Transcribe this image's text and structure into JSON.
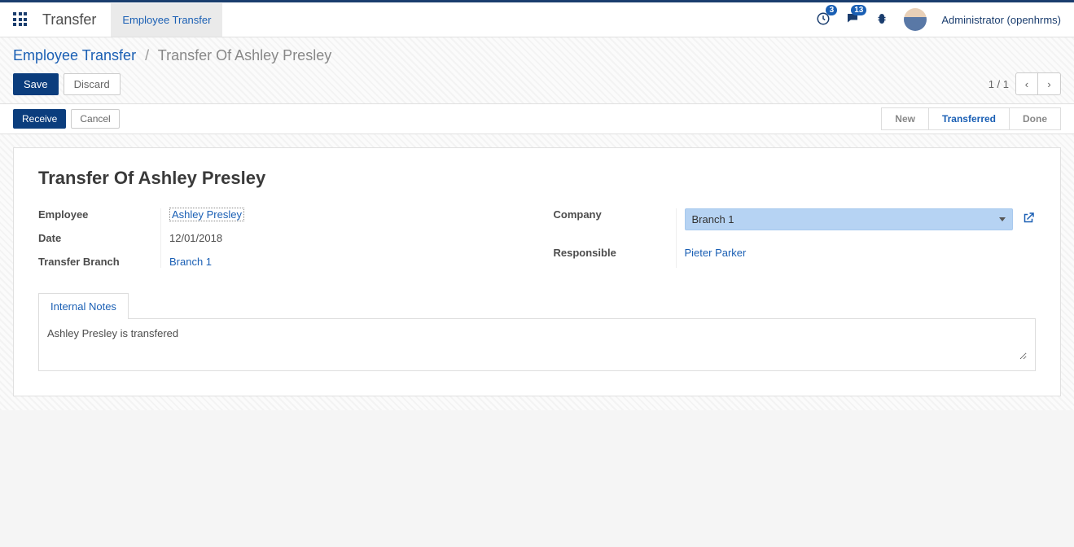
{
  "topbar": {
    "module": "Transfer",
    "active_tab": "Employee Transfer",
    "clock_badge": "3",
    "chat_badge": "13",
    "user": "Administrator (openhrms)"
  },
  "breadcrumb": {
    "root": "Employee Transfer",
    "current": "Transfer Of Ashley Presley"
  },
  "buttons": {
    "save": "Save",
    "discard": "Discard",
    "receive": "Receive",
    "cancel": "Cancel"
  },
  "pager": {
    "text": "1 / 1"
  },
  "status": {
    "new": "New",
    "transferred": "Transferred",
    "done": "Done"
  },
  "form": {
    "title": "Transfer Of Ashley Presley",
    "labels": {
      "employee": "Employee",
      "date": "Date",
      "branch": "Transfer Branch",
      "company": "Company",
      "responsible": "Responsible"
    },
    "values": {
      "employee": "Ashley Presley",
      "date": "12/01/2018",
      "branch": "Branch 1",
      "company": "Branch 1",
      "responsible": "Pieter Parker"
    }
  },
  "tabs": {
    "notes_label": "Internal Notes",
    "notes_value": "Ashley Presley is transfered"
  }
}
